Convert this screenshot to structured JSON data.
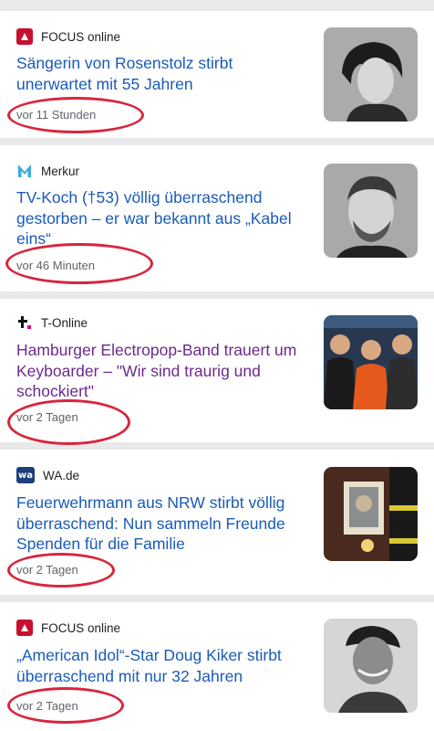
{
  "articles": [
    {
      "source": "FOCUS online",
      "source_icon": "focus-logo-icon",
      "title": "Sängerin von Rosenstolz stirbt unerwartet mit 55 Jahren",
      "time": "vor 11 Stunden",
      "thumbnail": "portrait-woman-photo"
    },
    {
      "source": "Merkur",
      "source_icon": "merkur-logo-icon",
      "title": "TV-Koch (†53) völlig überraschend gestorben – er war bekannt aus „Kabel eins“",
      "time": "vor 46 Minuten",
      "thumbnail": "portrait-man-photo"
    },
    {
      "source": "T-Online",
      "source_icon": "t-online-logo-icon",
      "title": "Hamburger Electropop-Band trauert um Keyboarder – \"Wir sind traurig und schockiert\"",
      "time": "vor 2 Tagen",
      "thumbnail": "band-photo"
    },
    {
      "source": "WA.de",
      "source_icon": "wa-logo-icon",
      "title": "Feuerwehrmann aus NRW stirbt völlig überraschend: Nun sammeln Freunde Spenden für die Familie",
      "time": "vor 2 Tagen",
      "thumbnail": "memorial-photo"
    },
    {
      "source": "FOCUS online",
      "source_icon": "focus-logo-icon",
      "title": "„American Idol“-Star Doug Kiker stirbt überraschend mit nur 32 Jahren",
      "time": "vor 2 Tagen",
      "thumbnail": "portrait-man-cap-photo"
    }
  ],
  "colors": {
    "title_link": "#1a5bb8",
    "title_visited": "#6b2a8c",
    "annotation_circle": "#d7263d",
    "focus_brand": "#c8102e",
    "merkur_brand": "#3fa9e0",
    "t_online_brand": "#e20074",
    "wa_brand": "#1e3f7a"
  }
}
